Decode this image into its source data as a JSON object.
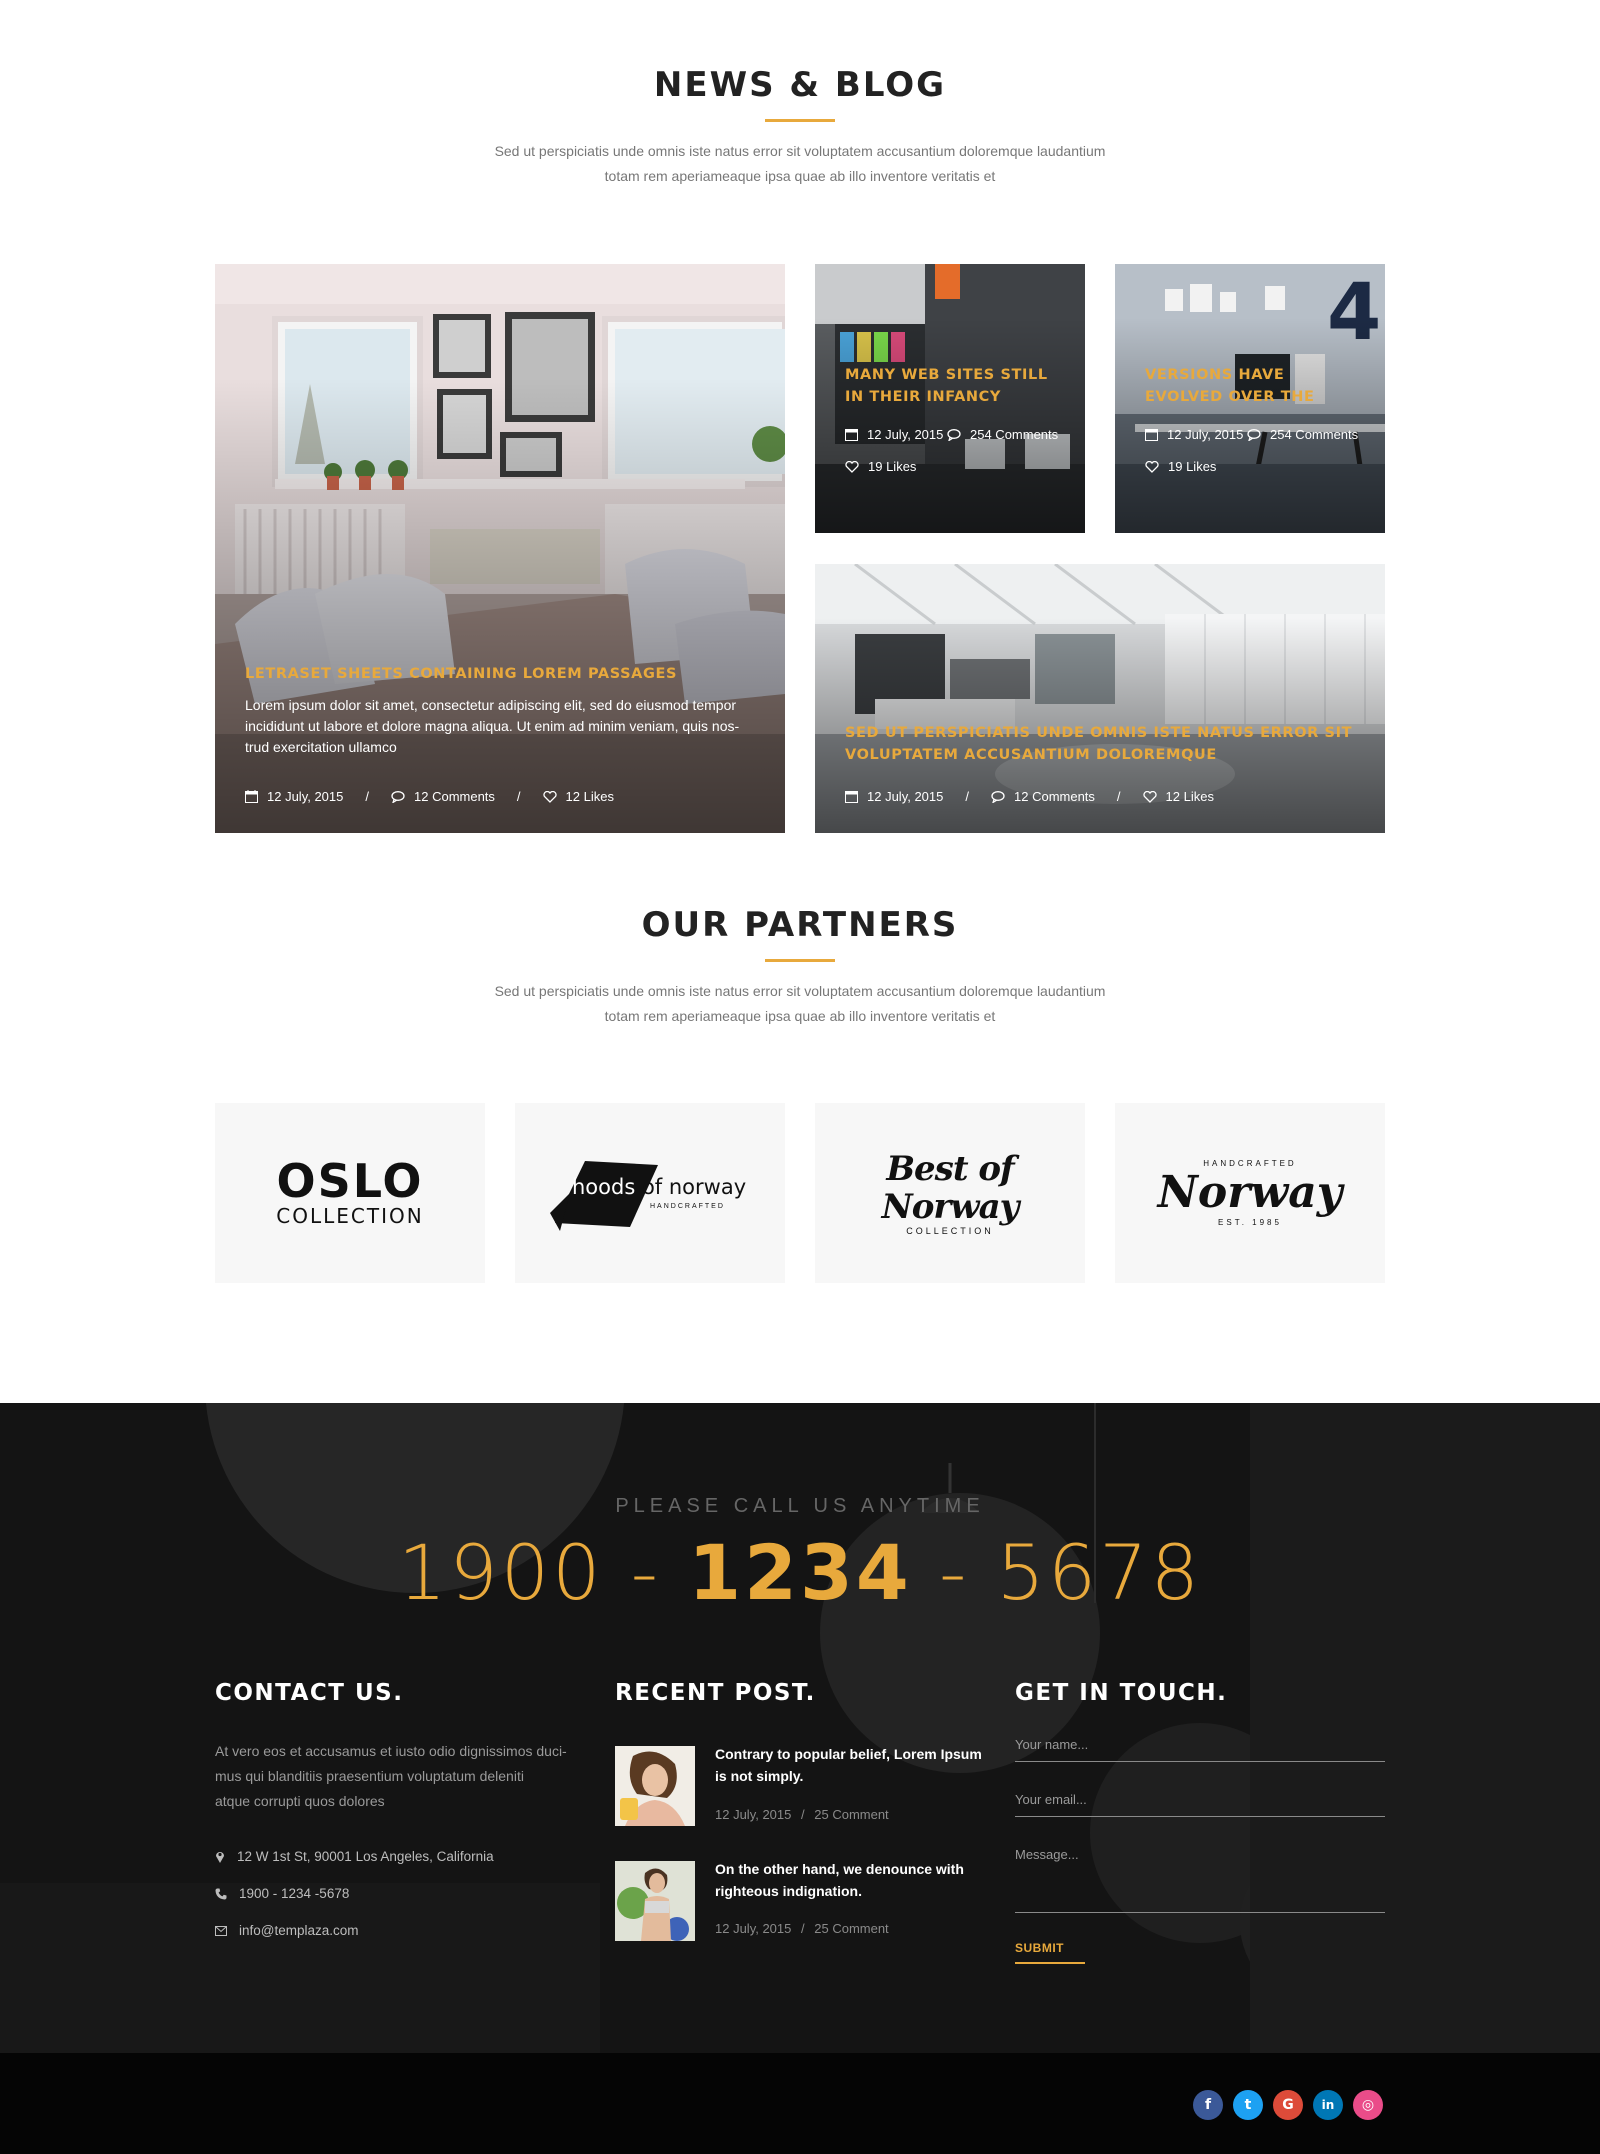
{
  "news": {
    "title": "NEWS & BLOG",
    "subtitle_line1": "Sed ut perspiciatis unde omnis iste natus error sit voluptatem accusantium doloremque laudantium",
    "subtitle_line2": "totam rem aperiameaque ipsa quae ab illo inventore veritatis et"
  },
  "posts": {
    "featured": {
      "title": "LETRASET SHEETS CONTAINING LOREM PASSAGES",
      "excerpt_line1": "Lorem ipsum dolor sit amet, consectetur adipiscing elit, sed do eiusmod tempor",
      "excerpt_line2": "incididunt ut labore et dolore magna aliqua. Ut enim ad minim veniam, quis nos-",
      "excerpt_line3": "trud exercitation ullamco",
      "date": "12 July, 2015",
      "comments": "12 Comments",
      "likes": "12 Likes",
      "sep": "/"
    },
    "small1": {
      "title_line1": "MANY WEB SITES STILL",
      "title_line2": "IN THEIR INFANCY",
      "date": "12 July, 2015",
      "comments": "254 Comments",
      "likes": "19 Likes"
    },
    "small2": {
      "title_line1": "VERSIONS HAVE",
      "title_line2": "EVOLVED OVER THE",
      "date": "12 July, 2015",
      "comments": "254 Comments",
      "likes": "19 Likes"
    },
    "wide": {
      "title_line1": "SED UT PERSPICIATIS UNDE OMNIS ISTE NATUS ERROR SIT",
      "title_line2": "VOLUPTATEM ACCUSANTIUM DOLOREMQUE",
      "date": "12 July, 2015",
      "comments": "12 Comments",
      "likes": "12 Likes",
      "sep": "/"
    }
  },
  "partners": {
    "title": "OUR PARTNERS",
    "subtitle_line1": "Sed ut perspiciatis unde omnis iste natus error sit voluptatem accusantium doloremque laudantium",
    "subtitle_line2": "totam rem aperiameaque ipsa quae ab illo inventore veritatis et",
    "logos": [
      {
        "main": "OSLO",
        "sub": "COLLECTION"
      },
      {
        "main": "hoods of norway",
        "sub": "HANDCRAFTED"
      },
      {
        "main": "Best of Norway",
        "sub": "COLLECTION"
      },
      {
        "top": "HANDCRAFTED",
        "main": "Norway",
        "sub": "EST. 1985"
      }
    ]
  },
  "call": {
    "label": "PLEASE CALL US ANYTIME",
    "part1": "1900",
    "dash1": "-",
    "part2": "1234",
    "dash2": "-",
    "part3": "5678"
  },
  "contact": {
    "heading": "CONTACT US.",
    "text_line1": "At vero eos et accusamus et iusto odio dignissimos duci-",
    "text_line2": "mus qui blanditiis praesentium voluptatum deleniti",
    "text_line3": "atque corrupti quos dolores",
    "address": "12 W 1st St, 90001 Los Angeles, California",
    "phone": "1900 - 1234 -5678",
    "email": "info@templaza.com"
  },
  "recent": {
    "heading": "RECENT POST.",
    "items": [
      {
        "title_line1": "Contrary to popular belief, Lorem Ipsum",
        "title_line2": "is not simply.",
        "date": "12 July, 2015",
        "comments": "25 Comment"
      },
      {
        "title_line1": "On the other hand, we denounce with",
        "title_line2": "righteous indignation.",
        "date": "12 July, 2015",
        "comments": "25 Comment"
      }
    ],
    "sep": "/"
  },
  "touch": {
    "heading": "GET IN TOUCH.",
    "name_placeholder": "Your name...",
    "email_placeholder": "Your email...",
    "message_placeholder": "Message...",
    "submit": "SUBMIT"
  },
  "social": [
    {
      "name": "facebook",
      "glyph": "f",
      "color": "#3b5998"
    },
    {
      "name": "twitter",
      "glyph": "t",
      "color": "#1da1f2"
    },
    {
      "name": "google",
      "glyph": "G",
      "color": "#dd4b39"
    },
    {
      "name": "linkedin",
      "glyph": "in",
      "color": "#0077b5"
    },
    {
      "name": "dribbble",
      "glyph": "◎",
      "color": "#ea4c89"
    }
  ],
  "colors": {
    "accent": "#e8a93c",
    "footer_bg": "#141414",
    "bottom_bg": "#050505"
  }
}
